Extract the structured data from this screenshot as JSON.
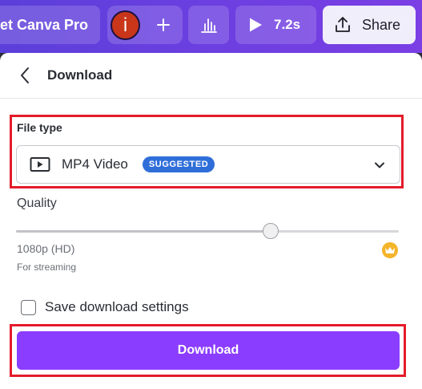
{
  "toolbar": {
    "get_pro_label": "et Canva Pro",
    "avatar_initial": "i",
    "play_time": "7.2s",
    "share_label": "Share"
  },
  "panel": {
    "title": "Download",
    "file_type": {
      "label": "File type",
      "selected_value": "MP4 Video",
      "badge": "SUGGESTED"
    },
    "quality": {
      "label": "Quality",
      "resolution": "1080p (HD)",
      "description": "For streaming",
      "level_fraction": 0.67
    },
    "save_settings": {
      "label": "Save download settings",
      "checked": false
    },
    "download_button_label": "Download"
  },
  "colors": {
    "accent": "#8b3dff",
    "highlight_border": "#e41b2a",
    "badge": "#2f6ed9",
    "crown": "#f4b52a",
    "toolbar": "#6a3fe0"
  },
  "icons": [
    "plus-icon",
    "bar-chart-icon",
    "play-icon",
    "upload-icon",
    "back-arrow-icon",
    "video-icon",
    "chevron-down-icon",
    "crown-icon"
  ]
}
